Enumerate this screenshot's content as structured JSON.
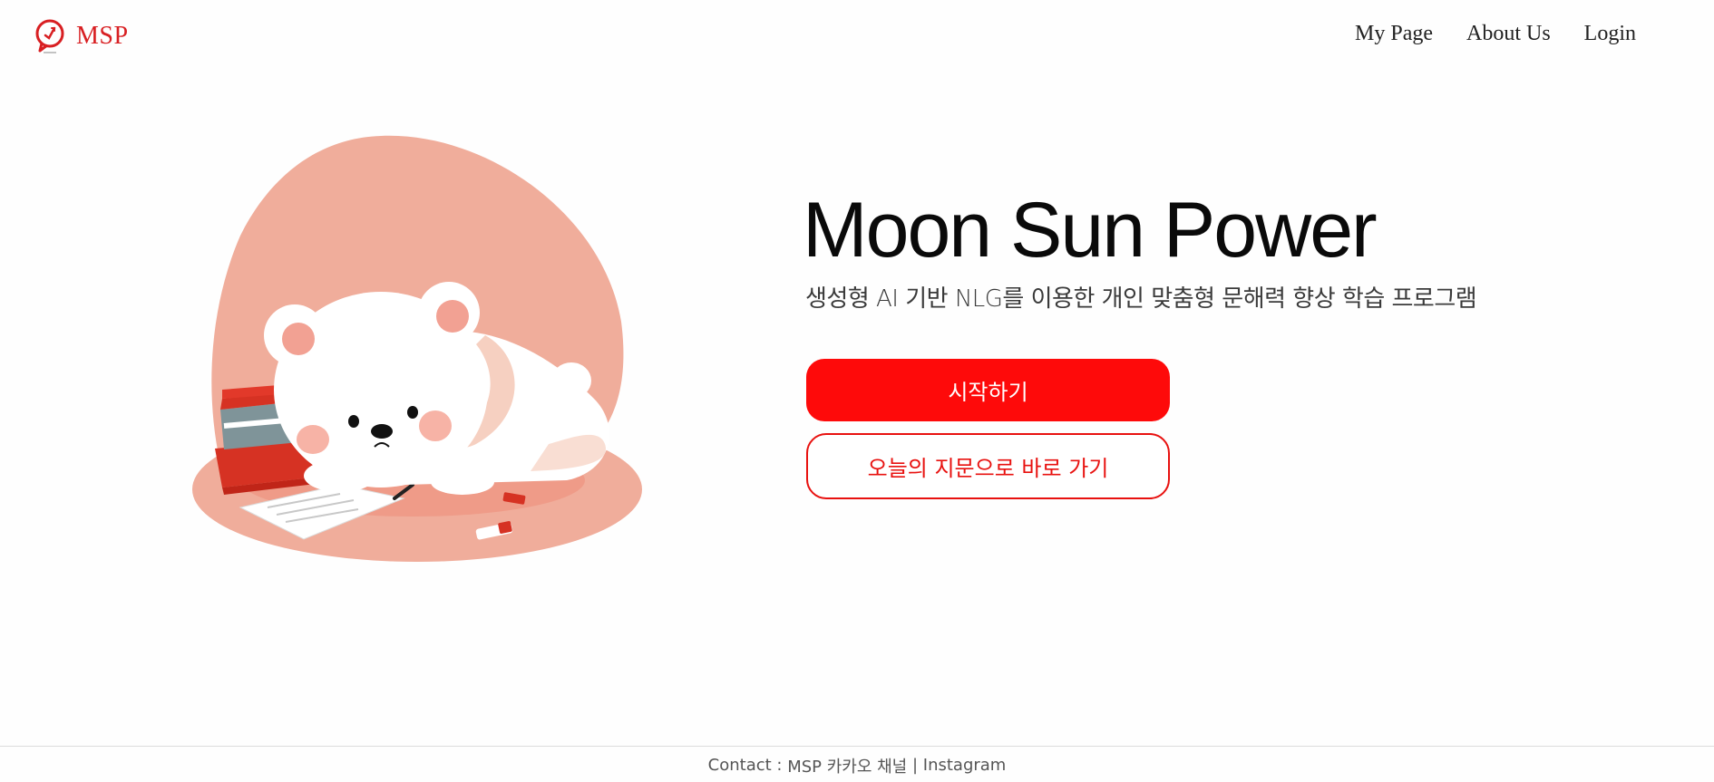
{
  "header": {
    "logo_text": "MSP",
    "logo_icon": "chat-bubble-check-icon",
    "nav": [
      {
        "label": "My Page"
      },
      {
        "label": "About Us"
      },
      {
        "label": "Login"
      }
    ]
  },
  "hero": {
    "title": "Moon Sun Power",
    "subtitle": "생성형 AI 기반 NLG를 이용한 개인 맞춤형 문해력 향상 학습 프로그램",
    "primary_button": "시작하기",
    "secondary_button": "오늘의 지문으로 바로 가기",
    "illustration": "polar-bear-studying-illustration"
  },
  "footer": {
    "prefix": "Contact : ",
    "kakao": "MSP 카카오 채널",
    "separator": " | ",
    "instagram": "Instagram"
  },
  "colors": {
    "brand": "#d81f22",
    "primary_button": "#fe0a0a",
    "secondary_border": "#e8110f",
    "illustration_bg": "#f0ad9b"
  }
}
